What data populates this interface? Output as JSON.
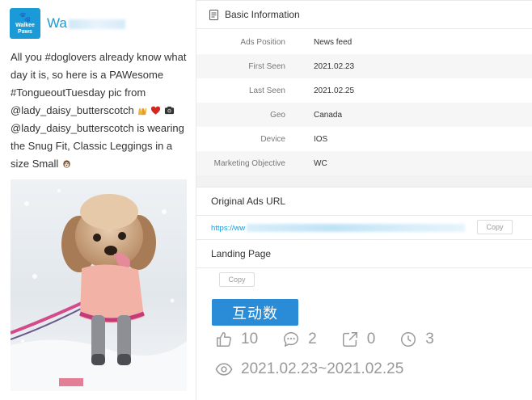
{
  "post": {
    "logo_line1": "Walkee",
    "logo_line2": "Paws",
    "advertiser_visible": "Wa",
    "text_before_emojis": "All you #doglovers already know what day it is, so here is a PAWesome #TongueoutTuesday pic from @lady_daisy_butterscotch ",
    "text_after_emojis": " @lady_daisy_butterscotch is wearing the Snug Fit, Classic Leggings in a size Small "
  },
  "basic_info": {
    "title": "Basic Information",
    "rows": [
      {
        "label": "Ads Position",
        "value": "News feed"
      },
      {
        "label": "First Seen",
        "value": "2021.02.23"
      },
      {
        "label": "Last Seen",
        "value": "2021.02.25"
      },
      {
        "label": "Geo",
        "value": "Canada"
      },
      {
        "label": "Device",
        "value": "IOS"
      },
      {
        "label": "Marketing Objective",
        "value": "WC"
      }
    ]
  },
  "original_url": {
    "title": "Original Ads URL",
    "url_visible_start": "https://ww",
    "url_visible_mid": ".eb",
    "url_visible_mid2": ".co",
    "copy_label": "Copy"
  },
  "landing_page": {
    "title": "Landing Page",
    "copy_label": "Copy"
  },
  "interaction": {
    "badge": "互动数",
    "likes": "10",
    "comments": "2",
    "shares": "0",
    "clock": "3",
    "date_range": "2021.02.23~2021.02.25"
  },
  "colors": {
    "accent": "#1a9ad6",
    "badge": "#2a8cd6",
    "stat_gray": "#999999"
  }
}
